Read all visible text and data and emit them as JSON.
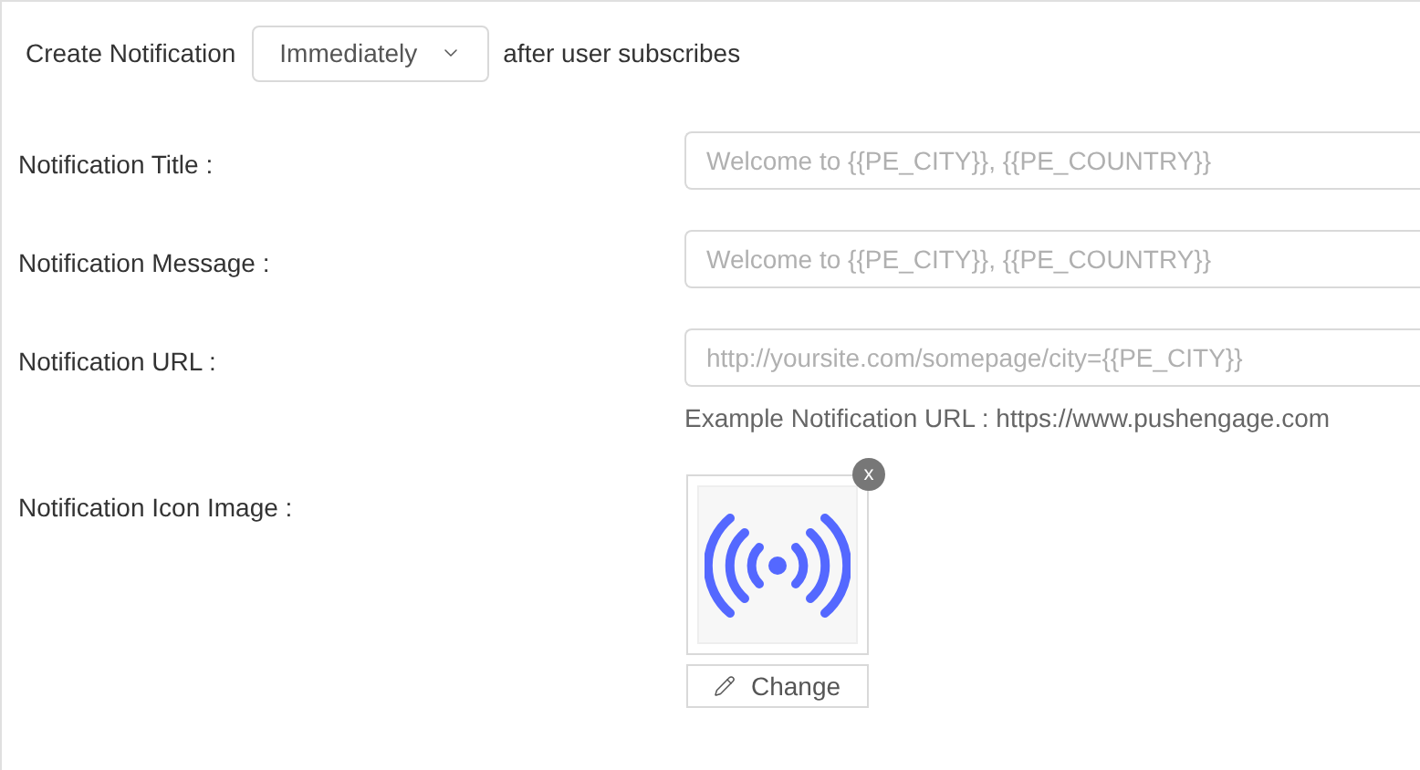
{
  "schedule": {
    "label": "Create Notification",
    "dropdown_value": "Immediately",
    "suffix": "after user subscribes"
  },
  "fields": [
    {
      "label": "Notification Title :",
      "placeholder": "Welcome to {{PE_CITY}}, {{PE_COUNTRY}}"
    },
    {
      "label": "Notification Message :",
      "placeholder": "Welcome to {{PE_CITY}}, {{PE_COUNTRY}}"
    },
    {
      "label": "Notification URL :",
      "placeholder": "http://yoursite.com/somepage/city={{PE_CITY}}",
      "hint": "Example Notification URL : https://www.pushengage.com"
    }
  ],
  "icon_image": {
    "label": "Notification Icon Image :",
    "remove_label": "x",
    "change_label": "Change"
  }
}
